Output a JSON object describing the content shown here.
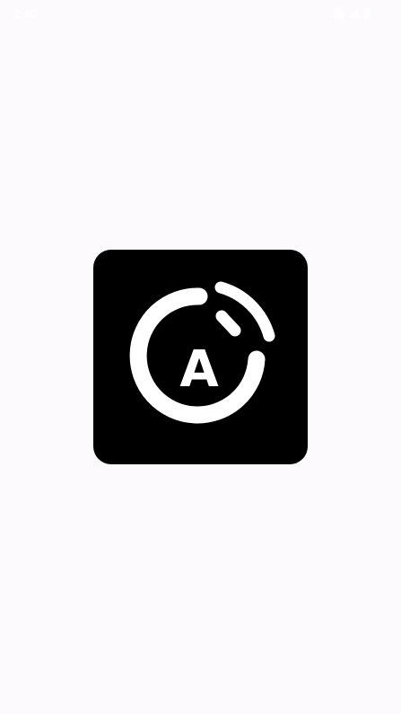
{
  "status_bar": {
    "time": "3:40"
  },
  "splash": {
    "logo_letter": "A",
    "logo_background_color": "#000000",
    "logo_foreground_color": "#ffffff",
    "page_background_color": "#fcfafd"
  }
}
